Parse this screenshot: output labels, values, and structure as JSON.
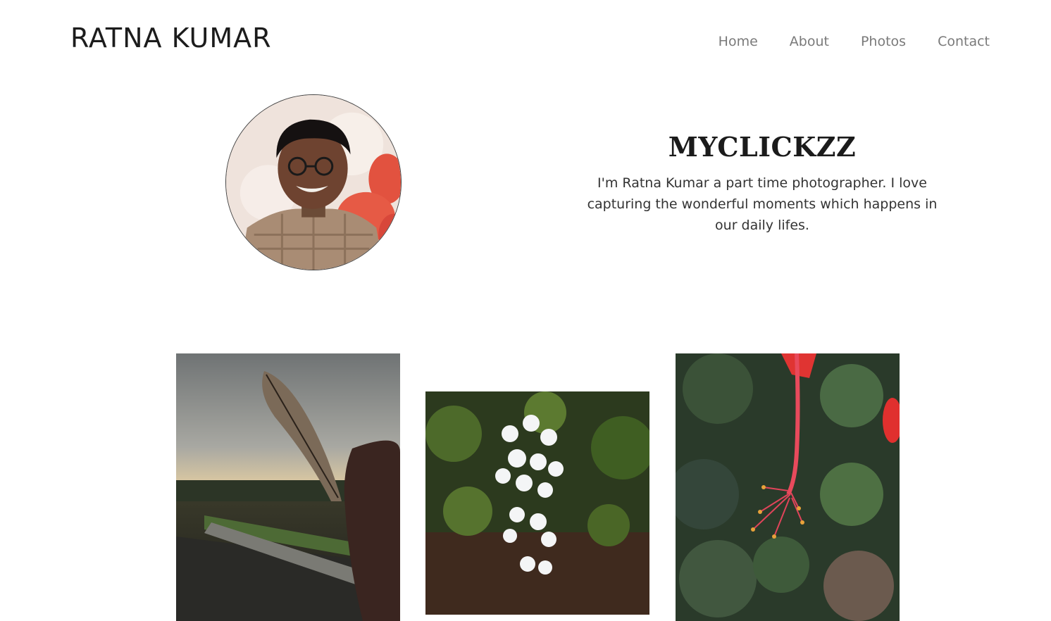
{
  "header": {
    "brand": "RATNA KUMAR",
    "nav": [
      {
        "label": "Home"
      },
      {
        "label": "About"
      },
      {
        "label": "Photos"
      },
      {
        "label": "Contact"
      }
    ]
  },
  "intro": {
    "title": "MYCLICKZZ",
    "description": "I'm Ratna Kumar a part time photographer. I love capturing the wonderful moments which happens in our daily lifes."
  },
  "gallery": {
    "photos": [
      {
        "subject": "feather at sunset"
      },
      {
        "subject": "white flowers"
      },
      {
        "subject": "red hibiscus stamen"
      }
    ]
  }
}
